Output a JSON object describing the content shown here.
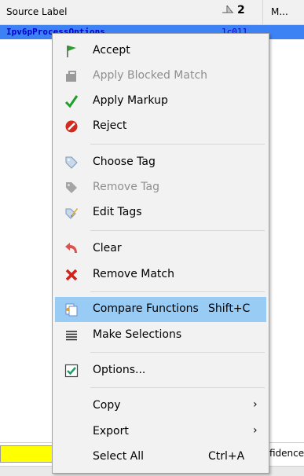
{
  "table": {
    "header": {
      "source_label": "Source Label",
      "sort_indicator": "2",
      "col3": "M..."
    },
    "selected_row": {
      "name": "Ipv6pProcessOptions",
      "address": "1c011"
    },
    "bottom_right_text": "fidence"
  },
  "menu": {
    "items": [
      {
        "label": "Accept",
        "icon": "green-flag-icon",
        "enabled": true
      },
      {
        "label": "Apply Blocked Match",
        "icon": "blocked-match-icon",
        "enabled": false
      },
      {
        "label": "Apply Markup",
        "icon": "checkmark-icon",
        "enabled": true
      },
      {
        "label": "Reject",
        "icon": "reject-icon",
        "enabled": true
      },
      {
        "label": "Choose Tag",
        "icon": "tag-icon",
        "enabled": true
      },
      {
        "label": "Remove Tag",
        "icon": "remove-tag-icon",
        "enabled": false
      },
      {
        "label": "Edit Tags",
        "icon": "edit-tags-icon",
        "enabled": true
      },
      {
        "label": "Clear",
        "icon": "undo-arrow-icon",
        "enabled": true
      },
      {
        "label": "Remove Match",
        "icon": "red-x-icon",
        "enabled": true
      },
      {
        "label": "Compare Functions",
        "shortcut": "Shift+C",
        "icon": "compare-functions-icon",
        "enabled": true,
        "highlighted": true
      },
      {
        "label": "Make Selections",
        "icon": "lines-icon",
        "enabled": true
      },
      {
        "label": "Options...",
        "icon": "checkbox-icon",
        "enabled": true
      },
      {
        "label": "Copy",
        "submenu": true,
        "enabled": true
      },
      {
        "label": "Export",
        "submenu": true,
        "enabled": true
      },
      {
        "label": "Select All",
        "shortcut": "Ctrl+A",
        "enabled": true
      }
    ]
  },
  "colors": {
    "selection": "#3d82f5",
    "menu_highlight": "#99ccf5",
    "address_text": "#0000cc",
    "yellow_cell": "#ffff00"
  }
}
